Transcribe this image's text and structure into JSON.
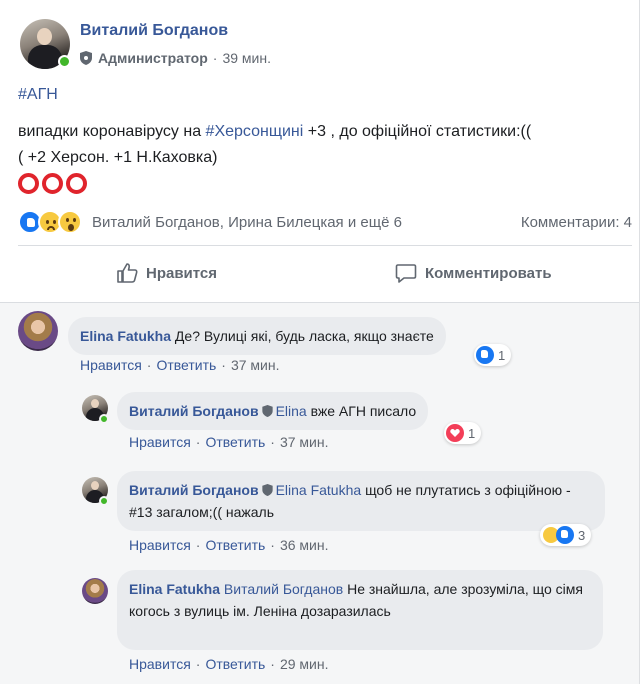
{
  "post": {
    "author": "Виталий Богданов",
    "role": "Администратор",
    "time_sep": "·",
    "time": "39 мин.",
    "hashtag": "#АГН",
    "text_before": "випадки коронавірусу на ",
    "text_tag": "#Херсонщині",
    "text_after": " +3 , до офіційної статистики:((",
    "text_line2": "( +2 Херсон. +1 Н.Каховка)",
    "reaction_names": "Виталий Богданов, Ирина Билецкая и ещё 6",
    "comments_count": "Комментарии: 4",
    "reactions": [
      "like",
      "sad",
      "wow"
    ],
    "like_label": "Нравится",
    "comment_label": "Комментировать"
  },
  "comments": [
    {
      "author": "Elina Fatukha",
      "text": "Де? Вулиці які, будь ласка, якщо знаєте",
      "like": "Нравится",
      "reply": "Ответить",
      "sep": "·",
      "time": "37 мин.",
      "reaction_count": "1"
    },
    {
      "author": "Виталий Богданов",
      "mention": "Elina",
      "text": "вже АГН писало",
      "like": "Нравится",
      "reply": "Ответить",
      "sep": "·",
      "time": "37 мин.",
      "reaction_count": "1"
    },
    {
      "author": "Виталий Богданов",
      "mention": "Elina Fatukha",
      "text": "щоб не плутатись з офіційною - #13 загалом;(( нажаль",
      "like": "Нравится",
      "reply": "Ответить",
      "sep": "·",
      "time": "36 мин.",
      "reaction_count": "3"
    },
    {
      "author": "Elina Fatukha",
      "mention": "Виталий Богданов",
      "text": "Не знайшла, але зрозуміла, що сімя когось з вулиць ім. Леніна дозаразилась",
      "like": "Нравится",
      "reply": "Ответить",
      "sep": "·",
      "time": "29 мин."
    }
  ],
  "colors": {
    "link": "#385898",
    "like_blue": "#1877f2",
    "heart_red": "#f33e58",
    "emoji_yellow": "#f7c940",
    "circle_red": "#e0242c",
    "online_green": "#42b72a"
  }
}
